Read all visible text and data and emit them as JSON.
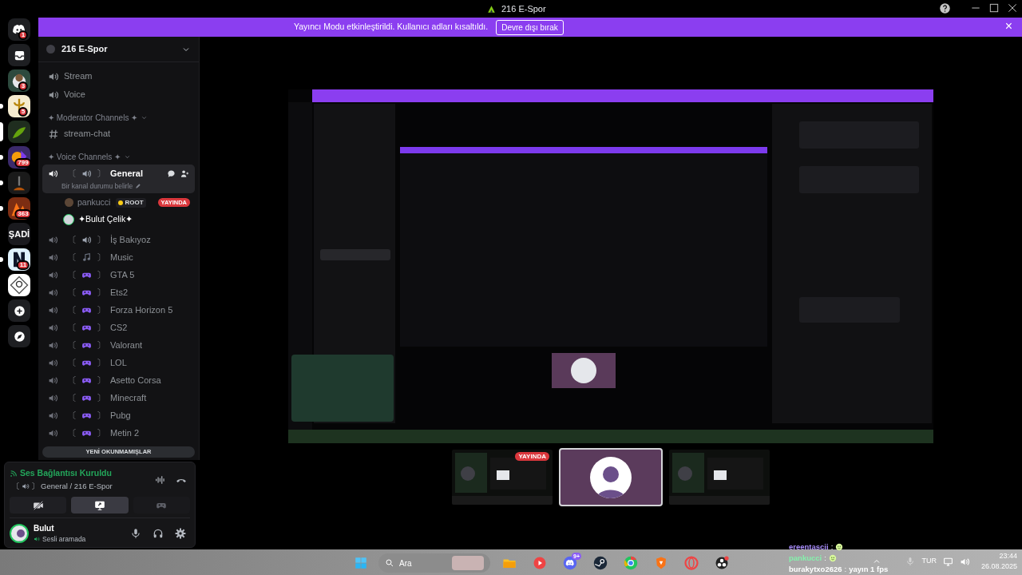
{
  "window": {
    "title": "216 E-Spor"
  },
  "banner": {
    "message": "Yayıncı Modu etkinleştirildi. Kullanıcı adları kısaltıldı.",
    "button": "Devre dışı bırak",
    "close": "×"
  },
  "servers": [
    {
      "kind": "home",
      "badge": "1",
      "unread": false,
      "selected": false
    },
    {
      "kind": "inbox",
      "unread": false,
      "selected": false
    },
    {
      "kind": "server",
      "badge": "3",
      "unread": false,
      "selected": false
    },
    {
      "kind": "server",
      "badge": "5",
      "unread": true,
      "selected": false
    },
    {
      "kind": "server",
      "unread": false,
      "selected": true
    },
    {
      "kind": "server",
      "badge": "799",
      "unread": true,
      "selected": false
    },
    {
      "kind": "server",
      "unread": true,
      "selected": false
    },
    {
      "kind": "server",
      "badge": "363",
      "unread": true,
      "selected": false
    },
    {
      "kind": "server",
      "label": "ŞADİ",
      "unread": false,
      "selected": false
    },
    {
      "kind": "server",
      "badge": "11",
      "unread": true,
      "selected": false
    },
    {
      "kind": "server",
      "unread": false,
      "selected": false
    },
    {
      "kind": "add",
      "unread": false,
      "selected": false
    },
    {
      "kind": "discover",
      "unread": false,
      "selected": false
    }
  ],
  "server": {
    "name": "216 E-Spor"
  },
  "channel_brackets": [
    "〔",
    "〕"
  ],
  "channels": [
    {
      "kind": "voice",
      "name": "Stream"
    },
    {
      "kind": "voice",
      "name": "Voice"
    },
    {
      "kind": "category",
      "name": "✦ Moderator Channels ✦"
    },
    {
      "kind": "text",
      "name": "stream-chat"
    },
    {
      "kind": "category",
      "name": "✦ Voice Channels ✦"
    },
    {
      "kind": "speaker",
      "name": "General",
      "selected": true,
      "status": "Bir kanal durumu belirle",
      "members": [
        {
          "name": "pankucci",
          "tag": "ROOT",
          "live": "YAYINDA"
        },
        {
          "name": "✦Bulut Çelik✦"
        }
      ]
    },
    {
      "kind": "speaker",
      "name": "İş Bakıyoz",
      "selected": false
    },
    {
      "kind": "note",
      "name": "Music",
      "selected": false
    },
    {
      "kind": "gamepad",
      "name": "GTA 5",
      "selected": false
    },
    {
      "kind": "gamepad",
      "name": "Ets2",
      "selected": false
    },
    {
      "kind": "gamepad",
      "name": "Forza Horizon 5",
      "selected": false
    },
    {
      "kind": "gamepad",
      "name": "CS2",
      "selected": false
    },
    {
      "kind": "gamepad",
      "name": "Valorant",
      "selected": false
    },
    {
      "kind": "gamepad",
      "name": "LOL",
      "selected": false
    },
    {
      "kind": "gamepad",
      "name": "Asetto Corsa",
      "selected": false
    },
    {
      "kind": "gamepad",
      "name": "Minecraft",
      "selected": false
    },
    {
      "kind": "gamepad",
      "name": "Pubg",
      "selected": false
    },
    {
      "kind": "gamepad",
      "name": "Metin 2",
      "selected": false
    }
  ],
  "unread_pill": "YENİ OKUNMAMIŞLAR",
  "voice_panel": {
    "status": "Ses Bağlantısı Kuruldu",
    "channel": "General / 216 E-Spor",
    "actions": [
      {
        "kind": "camera",
        "selected": false
      },
      {
        "kind": "screen",
        "selected": true
      },
      {
        "kind": "activity",
        "selected": false
      }
    ]
  },
  "user": {
    "name": "Bulut",
    "status": "Sesli aramada"
  },
  "stream": {
    "kind": "picture"
  },
  "thumbnails": [
    {
      "kind": "picture",
      "badge": "YAYINDA",
      "selected": false
    },
    {
      "kind": "avatar",
      "selected": true
    },
    {
      "kind": "picture",
      "selected": false
    }
  ],
  "taskbar": {
    "search": "Ara",
    "apps": [
      {
        "kind": "folder"
      },
      {
        "kind": "music"
      },
      {
        "kind": "discord",
        "badge": "9+"
      },
      {
        "kind": "steam"
      },
      {
        "kind": "chrome"
      },
      {
        "kind": "brave"
      },
      {
        "kind": "opera"
      },
      {
        "kind": "obs"
      }
    ],
    "language": "TUR",
    "time": "23:44",
    "date": "26.08.2025"
  },
  "overlay_chat": {
    "separator": ":",
    "messages": [
      {
        "user": "ereentascii",
        "color": "#a78bfa",
        "kind": "emoji"
      },
      {
        "user": "pankucci",
        "color": "#86efac",
        "kind": "emoji"
      },
      {
        "user": "burakytxo2626",
        "color": "#ffffff",
        "kind": "text",
        "text": "yayın 1 fps"
      }
    ]
  }
}
